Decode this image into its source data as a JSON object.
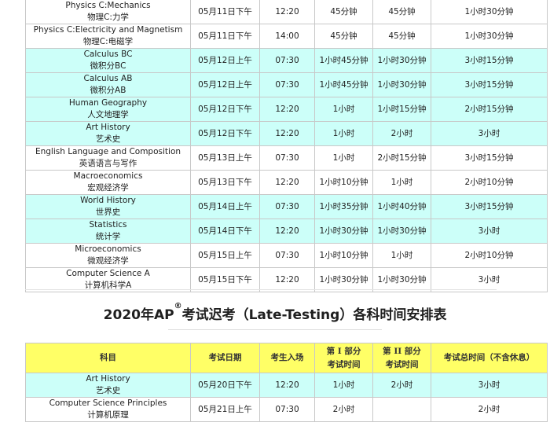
{
  "schedule": [
    {
      "subject_en": "Physics C:Mechanics",
      "subject_cn": "物理C:力学",
      "date": "05月11日下午",
      "entry": "12:20",
      "part1": "45分钟",
      "part2": "45分钟",
      "total": "1小时30分钟",
      "style": "white"
    },
    {
      "subject_en": "Physics C:Electricity and Magnetism",
      "subject_cn": "物理C:电磁学",
      "date": "05月11日下午",
      "entry": "14:00",
      "part1": "45分钟",
      "part2": "45分钟",
      "total": "1小时30分钟",
      "style": "white"
    },
    {
      "subject_en": "Calculus BC",
      "subject_cn": "微积分BC",
      "date": "05月12日上午",
      "entry": "07:30",
      "part1": "1小时45分钟",
      "part2": "1小时30分钟",
      "total": "3小时15分钟",
      "style": "cyan"
    },
    {
      "subject_en": "Calculus AB",
      "subject_cn": "微积分AB",
      "date": "05月12日上午",
      "entry": "07:30",
      "part1": "1小时45分钟",
      "part2": "1小时30分钟",
      "total": "3小时15分钟",
      "style": "cyan"
    },
    {
      "subject_en": "Human Geography",
      "subject_cn": "人文地理学",
      "date": "05月12日下午",
      "entry": "12:20",
      "part1": "1小时",
      "part2": "1小时15分钟",
      "total": "2小时15分钟",
      "style": "cyan"
    },
    {
      "subject_en": "Art History",
      "subject_cn": "艺术史",
      "date": "05月12日下午",
      "entry": "12:20",
      "part1": "1小时",
      "part2": "2小时",
      "total": "3小时",
      "style": "cyan"
    },
    {
      "subject_en": "English Language and Composition",
      "subject_cn": "英语语言与写作",
      "date": "05月13日上午",
      "entry": "07:30",
      "part1": "1小时",
      "part2": "2小时15分钟",
      "total": "3小时15分钟",
      "style": "white"
    },
    {
      "subject_en": "Macroeconomics",
      "subject_cn": "宏观经济学",
      "date": "05月13日下午",
      "entry": "12:20",
      "part1": "1小时10分钟",
      "part2": "1小时",
      "total": "2小时10分钟",
      "style": "white"
    },
    {
      "subject_en": "World History",
      "subject_cn": "世界史",
      "date": "05月14日上午",
      "entry": "07:30",
      "part1": "1小时35分钟",
      "part2": "1小时40分钟",
      "total": "3小时15分钟",
      "style": "cyan"
    },
    {
      "subject_en": "Statistics",
      "subject_cn": "统计学",
      "date": "05月14日下午",
      "entry": "12:20",
      "part1": "1小时30分钟",
      "part2": "1小时30分钟",
      "total": "3小时",
      "style": "cyan"
    },
    {
      "subject_en": "Microeconomics",
      "subject_cn": "微观经济学",
      "date": "05月15日上午",
      "entry": "07:30",
      "part1": "1小时10分钟",
      "part2": "1小时",
      "total": "2小时10分钟",
      "style": "white"
    },
    {
      "subject_en": "Computer Science A",
      "subject_cn": "计算机科学A",
      "date": "05月15日下午",
      "entry": "12:20",
      "part1": "1小时30分钟",
      "part2": "1小时30分钟",
      "total": "3小时",
      "style": "white"
    }
  ],
  "late_testing": {
    "title_prefix": "2020年AP",
    "title_sup": "®",
    "title_suffix": "考试迟考（Late-Testing）各科时间安排表",
    "headers": {
      "subject": "科目",
      "date": "考试日期",
      "entry": "考生入场",
      "part1_line1": "第 I 部分",
      "part1_line2": "考试时间",
      "part2_line1": "第 II 部分",
      "part2_line2": "考试时间",
      "total": "考试总时间（不含休息）"
    },
    "rows": [
      {
        "subject_en": "Art History",
        "subject_cn": "艺术史",
        "date": "05月20日下午",
        "entry": "12:20",
        "part1": "1小时",
        "part2": "2小时",
        "total": "3小时",
        "style": "cyan"
      },
      {
        "subject_en": "Computer Science Principles",
        "subject_cn": "计算机原理",
        "date": "05月21日上午",
        "entry": "07:30",
        "part1": "2小时",
        "part2": "",
        "total": "2小时",
        "style": "white"
      }
    ]
  },
  "colors": {
    "cyan_row": "#ccfff9",
    "header_yellow": "#ffff66",
    "border": "#c8c8c8"
  }
}
